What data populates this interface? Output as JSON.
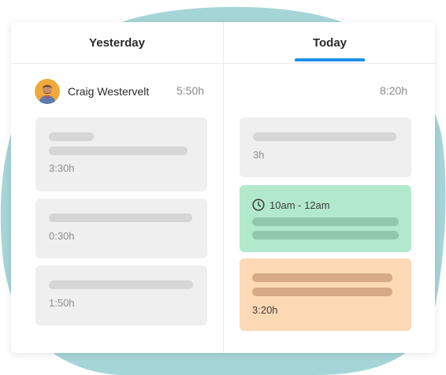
{
  "tabs": {
    "yesterday": "Yesterday",
    "today": "Today"
  },
  "user": {
    "name": "Craig Westervelt"
  },
  "totals": {
    "yesterday": "5:50h",
    "today": "8:20h"
  },
  "yesterday_entries": [
    {
      "duration": "3:30h"
    },
    {
      "duration": "0:30h"
    },
    {
      "duration": "1:50h"
    }
  ],
  "today_entries": [
    {
      "duration": "3h"
    },
    {
      "time_range": "10am - 12am",
      "icon": "clock-icon"
    },
    {
      "duration": "3:20h"
    }
  ],
  "colors": {
    "accent": "#1e90e6",
    "blob": "#a6d5d8",
    "entry_grey": "#efefef",
    "entry_green": "#b2e9cc",
    "entry_orange": "#fdd9b5"
  }
}
